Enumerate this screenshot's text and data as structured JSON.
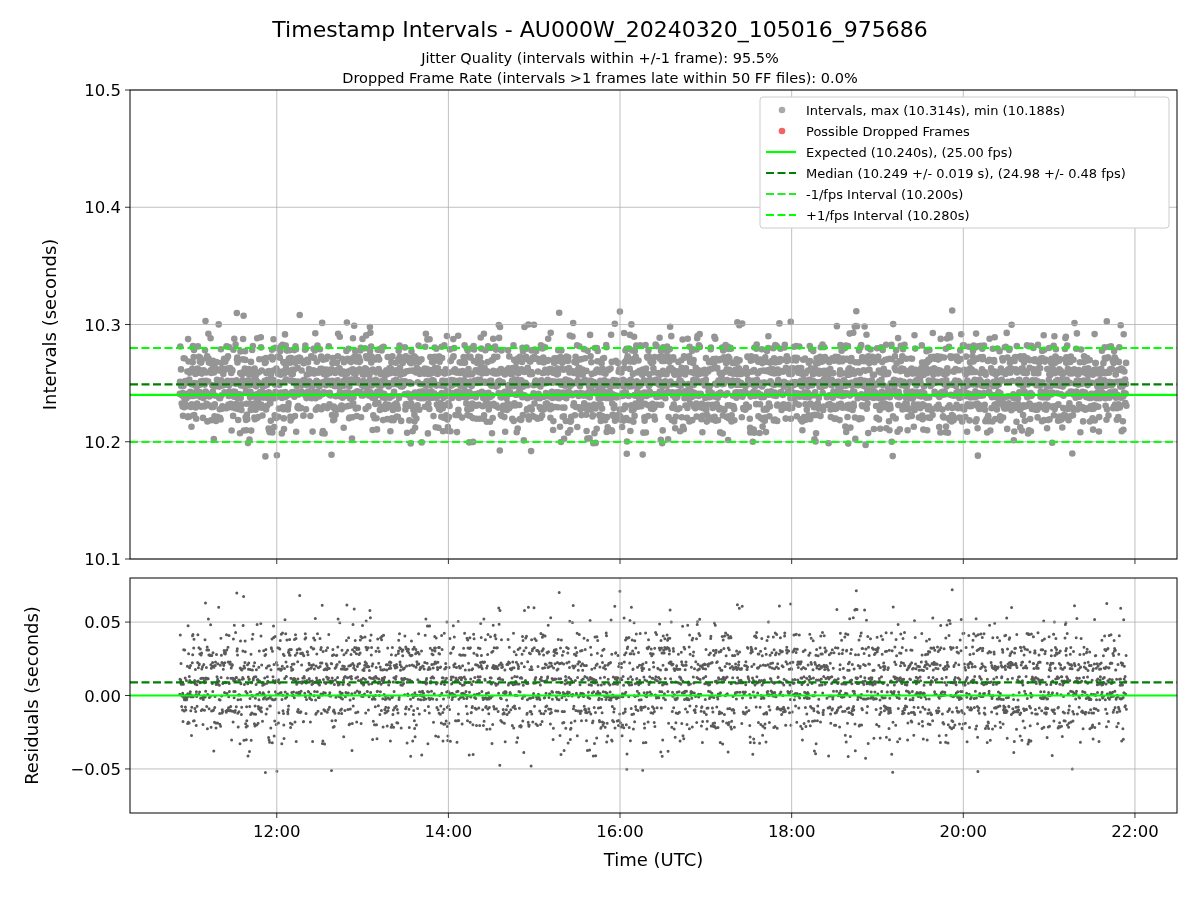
{
  "figure": {
    "title": "Timestamp Intervals - AU000W_20240320_105016_975686",
    "subtitle_lines": [
      "Jitter Quality (intervals within +/-1 frame): 95.5%",
      "Dropped Frame Rate (intervals >1 frames late within 50 FF files): 0.0%"
    ]
  },
  "intervals_plot": {
    "marker_legend": [
      {
        "label": "Intervals, max (10.314s), min (10.188s)",
        "color": "#a9a9a9"
      },
      {
        "label": "Possible Dropped Frames",
        "color": "#f26464"
      }
    ],
    "chart_data": {
      "type": "line",
      "grid": true,
      "ylabel": "Intervals (seconds)",
      "xlim": [
        10.29,
        22.49
      ],
      "ylim": [
        10.1,
        10.5
      ],
      "yticks": [
        {
          "value": 10.1,
          "label": "10.1"
        },
        {
          "value": 10.2,
          "label": "10.2"
        },
        {
          "value": 10.3,
          "label": "10.3"
        },
        {
          "value": 10.4,
          "label": "10.4"
        },
        {
          "value": 10.5,
          "label": "10.5"
        }
      ],
      "x": [
        10.29,
        22.49
      ],
      "series": [
        {
          "name": "Expected (10.240s), (25.00 fps)",
          "color": "#00ff00",
          "line_style": "solid",
          "values": [
            10.24,
            10.24
          ]
        },
        {
          "name": "Median (10.249 +/- 0.019 s), (24.98 +/- 0.48 fps)",
          "color": "#008000",
          "line_style": "dashed",
          "values": [
            10.249,
            10.249
          ]
        },
        {
          "name": "-1/fps Interval (10.200s)",
          "color": "#22ee22",
          "line_style": "dashed",
          "values": [
            10.2,
            10.2
          ]
        },
        {
          "name": "+1/fps Interval (10.280s)",
          "color": "#00ff00",
          "line_style": "dashed",
          "values": [
            10.28,
            10.28
          ]
        }
      ]
    }
  },
  "residuals_plot": {
    "chart_data": {
      "type": "line",
      "grid": true,
      "xlabel": "Time (UTC)",
      "ylabel": "Residuals (seconds)",
      "xlim": [
        10.29,
        22.49
      ],
      "ylim": [
        -0.08,
        0.08
      ],
      "xticks": [
        {
          "value": 12,
          "label": "12:00"
        },
        {
          "value": 14,
          "label": "14:00"
        },
        {
          "value": 16,
          "label": "16:00"
        },
        {
          "value": 18,
          "label": "18:00"
        },
        {
          "value": 20,
          "label": "20:00"
        },
        {
          "value": 22,
          "label": "22:00"
        }
      ],
      "yticks": [
        {
          "value": -0.05,
          "label": "−0.05"
        },
        {
          "value": 0,
          "label": "0.00"
        },
        {
          "value": 0.05,
          "label": "0.05"
        }
      ],
      "x": [
        10.29,
        22.49
      ],
      "series": [
        {
          "color": "#00ff00",
          "line_style": "solid",
          "values": [
            0,
            0
          ]
        },
        {
          "color": "#008000",
          "line_style": "dashed",
          "values": [
            0.009,
            0.009
          ]
        }
      ]
    }
  }
}
